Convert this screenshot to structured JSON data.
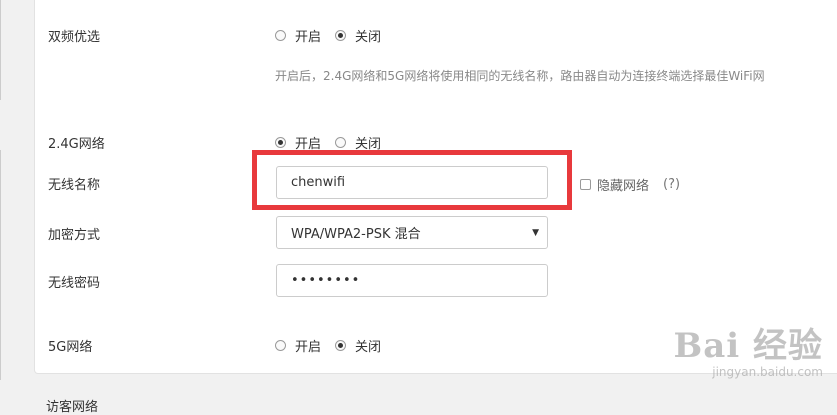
{
  "dual_band": {
    "label": "双频优选",
    "options": [
      {
        "label": "开启",
        "checked": false
      },
      {
        "label": "关闭",
        "checked": true
      }
    ],
    "description": "开启后，2.4G网络和5G网络将使用相同的无线名称，路由器自动为连接终端选择最佳WiFi网"
  },
  "band_24g": {
    "label": "2.4G网络",
    "options": [
      {
        "label": "开启",
        "checked": true
      },
      {
        "label": "关闭",
        "checked": false
      }
    ]
  },
  "ssid": {
    "label": "无线名称",
    "value": "chenwifi",
    "hide_label": "隐藏网络",
    "help": "(?)"
  },
  "encryption": {
    "label": "加密方式",
    "selected": "WPA/WPA2-PSK 混合"
  },
  "password": {
    "label": "无线密码",
    "masked": "••••••••"
  },
  "band_5g": {
    "label": "5G网络",
    "options": [
      {
        "label": "开启",
        "checked": false
      },
      {
        "label": "关闭",
        "checked": true
      }
    ]
  },
  "guest": {
    "label": "访客网络"
  },
  "watermark": {
    "main": "Bai 经验",
    "sub": "jingyan.baidu.com"
  },
  "colors": {
    "highlight": "#e8393c",
    "background": "#f1f1f1"
  }
}
